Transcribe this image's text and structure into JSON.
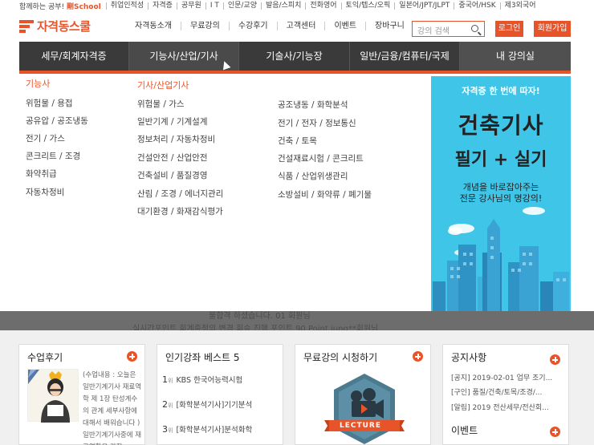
{
  "topbar": {
    "tagline": "함께하는 공부!",
    "tagline_brand": "剛School",
    "links": [
      "취업인적성",
      "자격증",
      "공무원",
      "I T",
      "인문/교양",
      "발음/스피치",
      "전화영어",
      "토익/텝스/오픽",
      "일본어/JPT/JLPT",
      "중국어/HSK",
      "제3외국어"
    ]
  },
  "header": {
    "logo_text": "자격동스쿨",
    "gnb": [
      "자격동소개",
      "무료강의",
      "수강후기",
      "고객센터",
      "이벤트",
      "장바구니"
    ],
    "search_placeholder": "강의 검색",
    "login_label": "로그인",
    "join_label": "회원가입"
  },
  "tabs": [
    "세무/회계자격증",
    "기능사/산업/기사",
    "기술사/기능장",
    "일반/금융/컴퓨터/국제",
    "내 강의실"
  ],
  "mega": {
    "col1": {
      "head": "기능사",
      "items": [
        "위험물 / 용접",
        "공유압 / 공조냉동",
        "전기 / 가스",
        "콘크리트 / 조경",
        "화약취급",
        "자동차정비"
      ]
    },
    "col2": {
      "head": "기사/산업기사",
      "items": [
        "위험물 / 가스",
        "일반기계 / 기계설계",
        "정보처리 / 자동차정비",
        "건설안전 / 산업안전",
        "건축설비 / 품질경영",
        "산림 / 조경 / 에너지관리",
        "대기환경 / 화재감식평가"
      ]
    },
    "col3": {
      "items": [
        "공조냉동 / 화학분석",
        "전기 / 전자 / 정보통신",
        "건축 / 토목",
        "건설재료시험 / 콘크리트",
        "식품 / 산업위생관리",
        "소방설비 / 화약류 / 폐기물"
      ]
    }
  },
  "banner": {
    "line1": "자격증 한 번에 따자!",
    "line2": "건축기사",
    "line3": "필기 + 실기",
    "line4a": "개념을 바로잡아주는",
    "line4b": "전문 강사님의 명강의!"
  },
  "ticker": {
    "line1": "불합격 하셨습니다. 01 회원님",
    "line2": "실시간포인트 회계증정의 변경 회승 진행 포인트 90 Point jung**회원님"
  },
  "boxes": {
    "review": {
      "title": "수업후기",
      "text": "(수업내용 : 오늘은 일반기계기사 재료역학 제 1장 탄성계수의 관계 세부사항에 대해서 배워습니다 ) 일반기계기사중에 재료역학을 가장 ."
    },
    "best": {
      "title": "인기강좌 베스트 5",
      "rank_suffix": "위",
      "rows": [
        {
          "rank": "1",
          "text": "KBS 한국어능력시험"
        },
        {
          "rank": "2",
          "text": "[화학분석기사]기기분석"
        },
        {
          "rank": "3",
          "text": "[화학분석기사]분석화학"
        }
      ]
    },
    "free": {
      "title": "무료강의 시청하기",
      "badge": "LECTURE"
    },
    "notice": {
      "title": "공지사항",
      "rows": [
        "[공지] 2019-02-01 업무 조기...",
        "[구인] 품질/건축/토목/조경/...",
        "[알림] 2019 전산세무/전산회..."
      ],
      "event_title": "이벤트"
    }
  }
}
